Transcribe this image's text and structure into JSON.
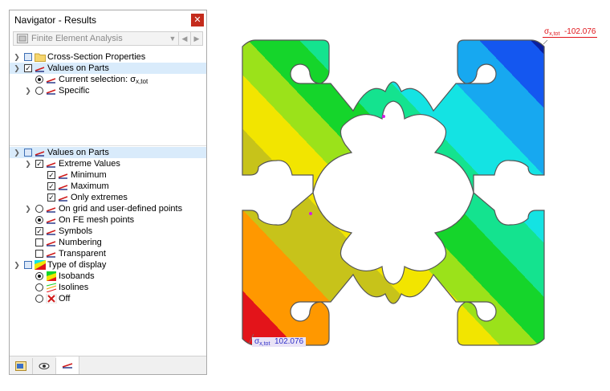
{
  "navigator": {
    "title": "Navigator - Results",
    "close_glyph": "✕",
    "module": "Finite Element Analysis",
    "tree1": {
      "cross_section": "Cross-Section Properties",
      "values_on_parts": "Values on Parts",
      "current_selection_prefix": "Current selection: ",
      "current_selection_symbol": "σ",
      "current_selection_sub": "x,tot",
      "specific": "Specific"
    },
    "tree2": {
      "values_on_parts": "Values on Parts",
      "extreme_values": "Extreme Values",
      "minimum": "Minimum",
      "maximum": "Maximum",
      "only_extremes": "Only extremes",
      "on_grid": "On grid and user-defined points",
      "on_fe_mesh": "On FE mesh points",
      "symbols": "Symbols",
      "numbering": "Numbering",
      "transparent": "Transparent",
      "type_of_display": "Type of display",
      "isobands": "Isobands",
      "isolines": "Isolines",
      "off": "Off"
    },
    "footer_icons": [
      "data-icon",
      "eye-icon",
      "result-arrow-icon"
    ]
  },
  "model": {
    "max_label": {
      "symbol": "σ",
      "sub": "x,tot",
      "value": "-102.076"
    },
    "min_label": {
      "symbol": "σ",
      "sub": "x,tot",
      "value": "102.076"
    },
    "colors": {
      "red": "#e3141a",
      "orange": "#ff9800",
      "yellow": "#f2e500",
      "olive": "#c7c31a",
      "light_green": "#9be21a",
      "green": "#15d52b",
      "teal": "#14e38f",
      "cyan": "#14e3e3",
      "light_blue": "#17a8f0",
      "blue": "#1457f0",
      "dark_blue": "#0a1f9e",
      "magenta": "#d21ee6",
      "label_red": "#e0141a",
      "label_blue": "#3030c8"
    }
  }
}
